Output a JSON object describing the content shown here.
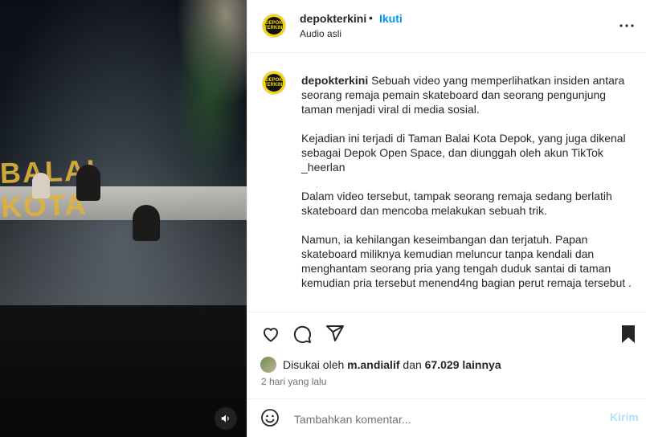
{
  "post": {
    "username": "depokterkini",
    "separator": "•",
    "follow_label": "Ikuti",
    "audio_label": "Audio asli",
    "avatar_text": "DEPOK TERKINI",
    "caption_username": "depokterkini",
    "caption_paragraphs": [
      "Sebuah video yang memperlihatkan insiden antara seorang remaja pemain skateboard dan seorang pengunjung taman menjadi viral di media sosial.",
      "Kejadian ini terjadi di Taman Balai Kota Depok, yang juga dikenal sebagai Depok Open Space, dan diunggah oleh akun TikTok _heerlan",
      "Dalam video tersebut, tampak seorang remaja sedang berlatih skateboard dan mencoba melakukan sebuah trik.",
      "Namun, ia kehilangan keseimbangan dan terjatuh. Papan skateboard miliknya kemudian meluncur tanpa kendali dan menghantam seorang pria yang tengah duduk santai di taman kemudian pria tersebut menend4ng bagian perut remaja tersebut ."
    ],
    "likes": {
      "prefix": "Disukai oleh",
      "user": "m.andialif",
      "conjunction": "dan",
      "count": "67.029 lainnya"
    },
    "date": "2 hari yang lalu",
    "comment": {
      "placeholder": "Tambahkan komentar...",
      "send_label": "Kirim"
    }
  },
  "media": {
    "sign_text": "BALAI KOTA"
  },
  "colors": {
    "accent": "#0095f6",
    "send_disabled": "#b2dffc",
    "muted": "#737373"
  },
  "icons": [
    "more-icon",
    "heart-icon",
    "comment-icon",
    "share-icon",
    "bookmark-icon",
    "emoji-icon",
    "audio-icon"
  ]
}
